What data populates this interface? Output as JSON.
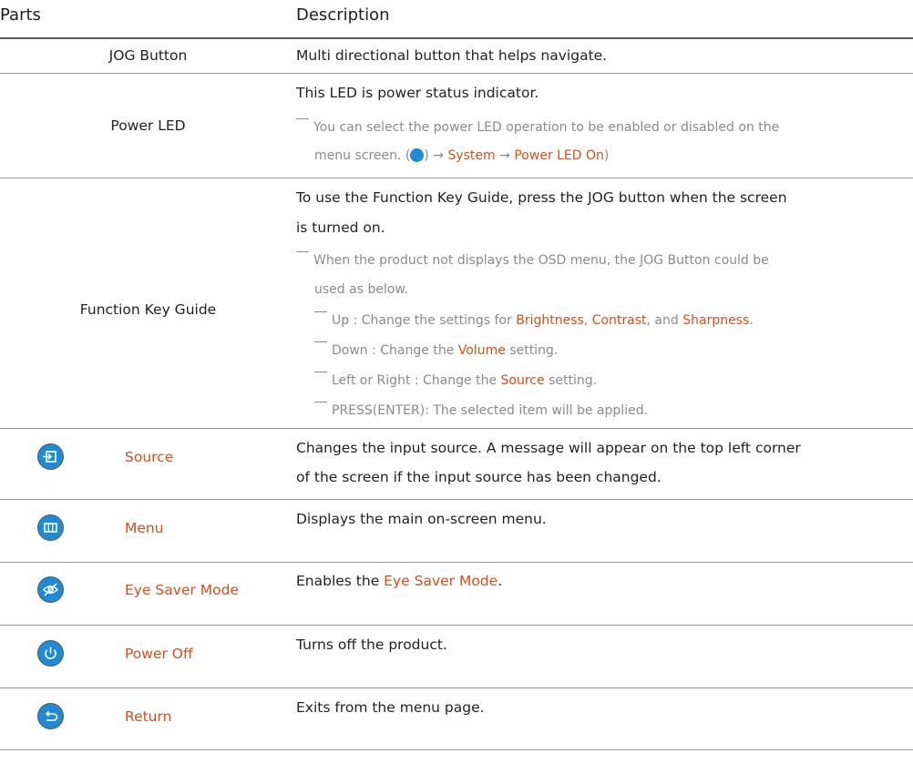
{
  "header": {
    "parts": "Parts",
    "description": "Description"
  },
  "rows": {
    "jog": {
      "part": "JOG Button",
      "desc": "Multi directional button that helps navigate."
    },
    "power_led": {
      "part": "Power LED",
      "desc": "This LED is power status indicator.",
      "note_a": "You can select the power LED operation to be enabled or disabled on the",
      "note_b_pre": "menu screen. (",
      "note_b_arrow1": ") → ",
      "note_b_system": "System",
      "note_b_arrow2": " → ",
      "note_b_led": "Power LED On",
      "note_b_close": ")"
    },
    "fkg": {
      "part": "Function Key Guide",
      "desc_a": "To use the Function Key Guide, press the JOG button when the screen",
      "desc_b": "is turned on.",
      "note_a": "When the product not displays the OSD menu, the JOG Button could be",
      "note_b": "used as below.",
      "up_pre": "Up : Change the settings for ",
      "up_brightness": "Brightness",
      "up_sep1": ", ",
      "up_contrast": "Contrast",
      "up_sep2": ", and ",
      "up_sharpness": "Sharpness",
      "up_end": ".",
      "down_pre": "Down : Change the ",
      "down_volume": "Volume",
      "down_post": " setting.",
      "lr_pre": "Left or Right : Change the ",
      "lr_source": "Source",
      "lr_post": " setting.",
      "press": "PRESS(ENTER): The selected item will be applied."
    },
    "source": {
      "part": "Source",
      "desc_a": "Changes the input source. A message will appear on the top left corner",
      "desc_b": "of the screen if the input source has been changed."
    },
    "menu": {
      "part": "Menu",
      "desc": "Displays the main on-screen menu."
    },
    "eye": {
      "part": "Eye Saver Mode",
      "desc_pre": "Enables the ",
      "desc_hl": "Eye Saver Mode",
      "desc_post": "."
    },
    "power_off": {
      "part": "Power Off",
      "desc": "Turns off the product."
    },
    "return": {
      "part": "Return",
      "desc": "Exits from the menu page."
    }
  },
  "colors": {
    "accent": "#d64d1a",
    "icon": "#1f8ad6",
    "note": "#8a8a8a"
  },
  "icons": [
    "source-icon",
    "menu-icon",
    "eye-saver-icon",
    "power-icon",
    "return-icon"
  ]
}
